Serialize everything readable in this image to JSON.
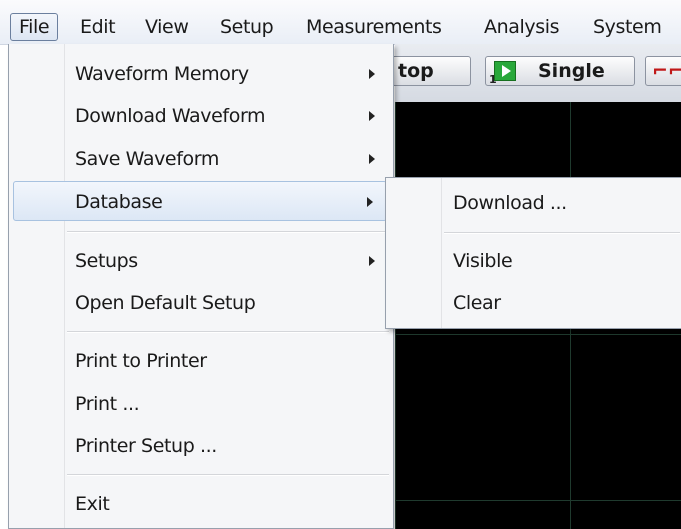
{
  "menubar": {
    "items": [
      "File",
      "Edit",
      "View",
      "Setup",
      "Measurements",
      "Analysis",
      "System"
    ]
  },
  "toolbar": {
    "stop_label": "top",
    "single_label": "Single",
    "single_num": "1",
    "extra_glyph": "⌐⌐"
  },
  "file_menu": {
    "items": [
      {
        "label": "Waveform Memory",
        "submenu": true
      },
      {
        "label": "Download Waveform",
        "submenu": true
      },
      {
        "label": "Save Waveform",
        "submenu": true
      },
      {
        "label": "Database",
        "submenu": true,
        "highlighted": true
      },
      {
        "label": "Setups",
        "submenu": true
      },
      {
        "label": "Open Default Setup",
        "submenu": false
      },
      {
        "label": "Print to Printer",
        "submenu": false
      },
      {
        "label": "Print ...",
        "submenu": false
      },
      {
        "label": "Printer Setup ...",
        "submenu": false
      },
      {
        "label": "Exit",
        "submenu": false
      }
    ]
  },
  "database_submenu": {
    "items": [
      {
        "label": "Download ..."
      },
      {
        "label": "Visible"
      },
      {
        "label": "Clear"
      }
    ]
  },
  "colors": {
    "accent_highlight": "#dce7f5",
    "scope_background": "#000000",
    "single_icon": "#29a83a"
  }
}
